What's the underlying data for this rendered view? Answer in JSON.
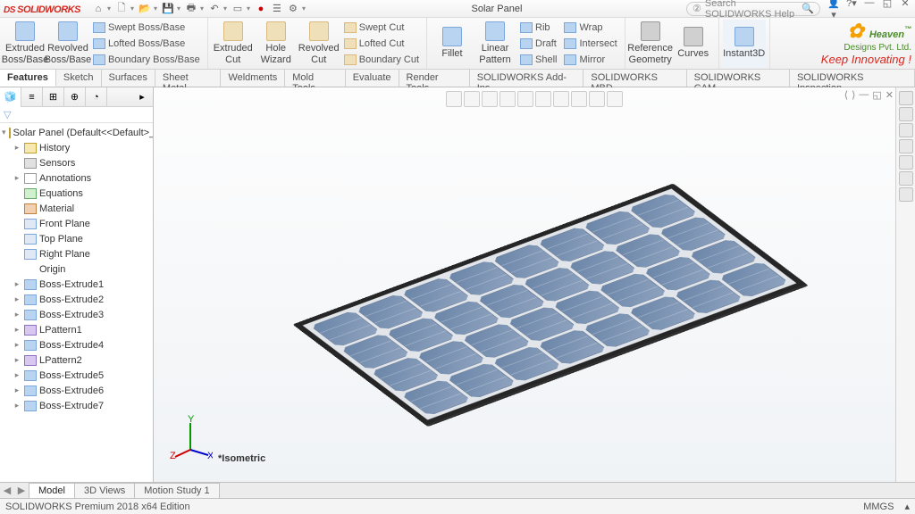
{
  "app": {
    "logo": "SOLIDWORKS",
    "title": "Solar Panel"
  },
  "search": {
    "placeholder": "Search SOLIDWORKS Help"
  },
  "ribbon": {
    "extruded_boss": "Extruded\nBoss/Base",
    "revolved_boss": "Revolved\nBoss/Base",
    "swept_boss": "Swept Boss/Base",
    "lofted_boss": "Lofted Boss/Base",
    "boundary_boss": "Boundary Boss/Base",
    "extruded_cut": "Extruded\nCut",
    "hole_wizard": "Hole\nWizard",
    "revolved_cut": "Revolved\nCut",
    "swept_cut": "Swept Cut",
    "lofted_cut": "Lofted Cut",
    "boundary_cut": "Boundary Cut",
    "fillet": "Fillet",
    "linear_pattern": "Linear\nPattern",
    "rib": "Rib",
    "draft": "Draft",
    "shell": "Shell",
    "wrap": "Wrap",
    "intersect": "Intersect",
    "mirror": "Mirror",
    "ref_geom": "Reference\nGeometry",
    "curves": "Curves",
    "instant3d": "Instant3D"
  },
  "cmd_tabs": [
    "Features",
    "Sketch",
    "Surfaces",
    "Sheet Metal",
    "Weldments",
    "Mold Tools",
    "Evaluate",
    "Render Tools",
    "SOLIDWORKS Add-Ins",
    "SOLIDWORKS MBD",
    "SOLIDWORKS CAM",
    "SOLIDWORKS Inspection"
  ],
  "tree": {
    "root": "Solar Panel  (Default<<Default>_Displ",
    "items": [
      {
        "icon": "folder",
        "label": "History",
        "exp": "▸"
      },
      {
        "icon": "sensor",
        "label": "Sensors",
        "exp": ""
      },
      {
        "icon": "ann",
        "label": "Annotations",
        "exp": "▸"
      },
      {
        "icon": "eq",
        "label": "Equations",
        "exp": ""
      },
      {
        "icon": "mat",
        "label": "Material <not specified>",
        "exp": ""
      },
      {
        "icon": "plane",
        "label": "Front Plane",
        "exp": ""
      },
      {
        "icon": "plane",
        "label": "Top Plane",
        "exp": ""
      },
      {
        "icon": "plane",
        "label": "Right Plane",
        "exp": ""
      },
      {
        "icon": "origin",
        "label": "Origin",
        "exp": ""
      },
      {
        "icon": "feat",
        "label": "Boss-Extrude1",
        "exp": "▸"
      },
      {
        "icon": "feat",
        "label": "Boss-Extrude2",
        "exp": "▸"
      },
      {
        "icon": "feat",
        "label": "Boss-Extrude3",
        "exp": "▸"
      },
      {
        "icon": "lpat",
        "label": "LPattern1",
        "exp": "▸"
      },
      {
        "icon": "feat",
        "label": "Boss-Extrude4",
        "exp": "▸"
      },
      {
        "icon": "lpat",
        "label": "LPattern2",
        "exp": "▸"
      },
      {
        "icon": "feat",
        "label": "Boss-Extrude5",
        "exp": "▸"
      },
      {
        "icon": "feat",
        "label": "Boss-Extrude6",
        "exp": "▸"
      },
      {
        "icon": "feat",
        "label": "Boss-Extrude7",
        "exp": "▸"
      }
    ]
  },
  "view_name": "*Isometric",
  "bottom_tabs": [
    "Model",
    "3D Views",
    "Motion Study 1"
  ],
  "status": {
    "left": "SOLIDWORKS Premium 2018 x64 Edition",
    "units": "MMGS"
  },
  "brand": {
    "ln1a": "✿ ",
    "ln1b": "Heaven",
    "ln2": "Designs Pvt. Ltd.",
    "ln3": "Keep Innovating !"
  }
}
